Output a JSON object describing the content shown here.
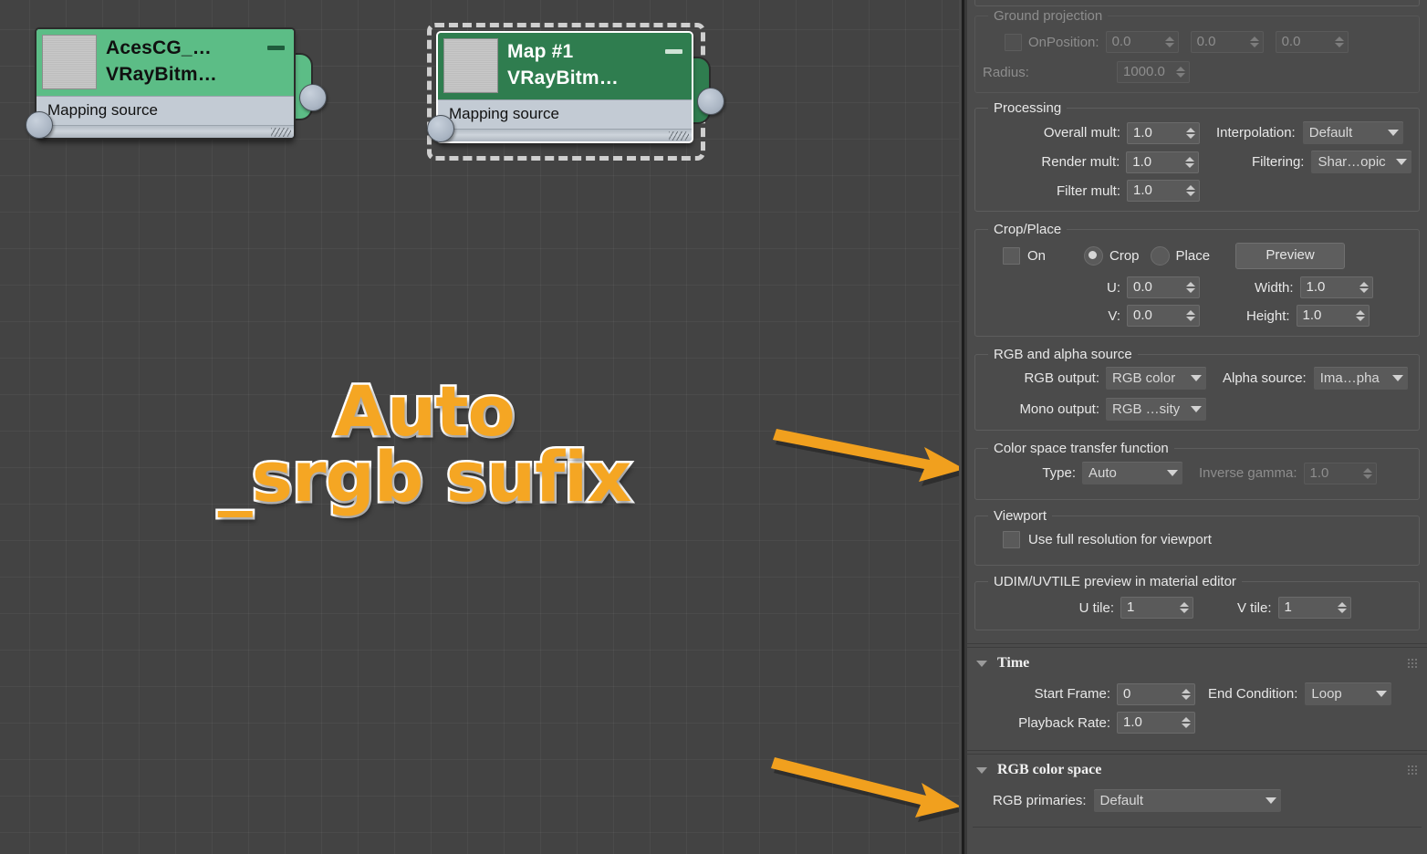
{
  "node_editor": {
    "nodes": [
      {
        "title": "AcesCG_…",
        "subtitle": "VRayBitm…",
        "slot_label": "Mapping source",
        "selected": false,
        "header_color": "#5cbd86",
        "title_color": "#101010",
        "minimize_icon": "minimize-icon"
      },
      {
        "title": "Map #1",
        "subtitle": "VRayBitm…",
        "slot_label": "Mapping source",
        "selected": true,
        "header_color": "#2f7d4f",
        "title_color": "#ffffff",
        "minimize_icon": "minimize-icon"
      }
    ],
    "annotation": {
      "line1": "Auto",
      "line2": "_srgb sufix",
      "color": "#f5a623",
      "outline_color": "#ffffff"
    },
    "arrows": [
      {
        "name": "arrow-to-colorspace-type",
        "color": "#f1a01e"
      },
      {
        "name": "arrow-to-rgb-primaries",
        "color": "#f1a01e"
      }
    ]
  },
  "panel": {
    "ground_projection": {
      "title": "Ground projection",
      "on_label": "On",
      "on_checked": false,
      "position_label": "Position:",
      "position": [
        "0.0",
        "0.0",
        "0.0"
      ],
      "radius_label": "Radius:",
      "radius": "1000.0",
      "disabled": true
    },
    "processing": {
      "title": "Processing",
      "overall_mult_label": "Overall mult:",
      "overall_mult": "1.0",
      "render_mult_label": "Render mult:",
      "render_mult": "1.0",
      "filter_mult_label": "Filter mult:",
      "filter_mult": "1.0",
      "interpolation_label": "Interpolation:",
      "interpolation": "Default",
      "filtering_label": "Filtering:",
      "filtering": "Shar…opic"
    },
    "crop_place": {
      "title": "Crop/Place",
      "on_label": "On",
      "on_checked": false,
      "crop_label": "Crop",
      "place_label": "Place",
      "mode": "Crop",
      "preview_label": "Preview",
      "u_label": "U:",
      "u": "0.0",
      "v_label": "V:",
      "v": "0.0",
      "width_label": "Width:",
      "width": "1.0",
      "height_label": "Height:",
      "height": "1.0"
    },
    "rgb_alpha_source": {
      "title": "RGB and alpha source",
      "rgb_output_label": "RGB output:",
      "rgb_output": "RGB color",
      "alpha_source_label": "Alpha source:",
      "alpha_source": "Ima…pha",
      "mono_output_label": "Mono output:",
      "mono_output": "RGB …sity"
    },
    "color_space_transfer": {
      "title": "Color space transfer function",
      "type_label": "Type:",
      "type": "Auto",
      "inverse_gamma_label": "Inverse gamma:",
      "inverse_gamma": "1.0",
      "inverse_gamma_disabled": true
    },
    "viewport": {
      "title": "Viewport",
      "full_res_label": "Use full resolution for viewport",
      "full_res_checked": false
    },
    "udim": {
      "title": "UDIM/UVTILE preview in material editor",
      "u_tile_label": "U tile:",
      "u_tile": "1",
      "v_tile_label": "V tile:",
      "v_tile": "1"
    },
    "time_rollout": {
      "header": "Time",
      "expanded": true,
      "start_frame_label": "Start Frame:",
      "start_frame": "0",
      "playback_rate_label": "Playback Rate:",
      "playback_rate": "1.0",
      "end_condition_label": "End Condition:",
      "end_condition": "Loop"
    },
    "rgb_color_space_rollout": {
      "header": "RGB color space",
      "expanded": true,
      "rgb_primaries_label": "RGB primaries:",
      "rgb_primaries": "Default"
    }
  }
}
